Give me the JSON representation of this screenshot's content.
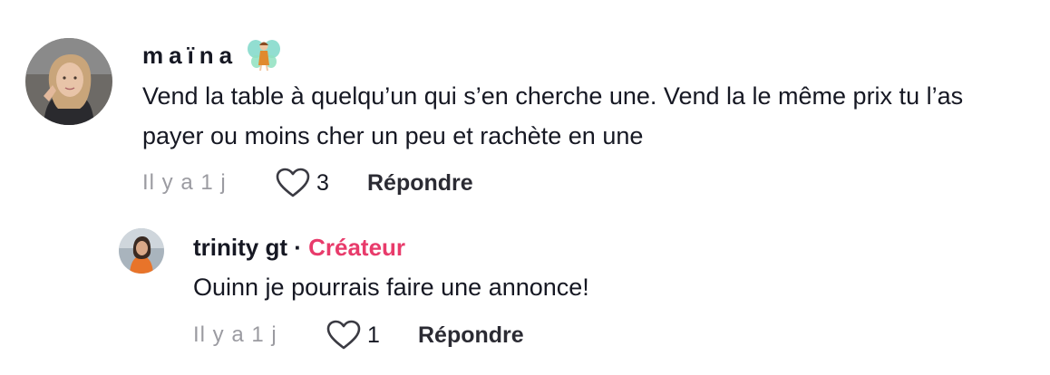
{
  "comment": {
    "username": "maïna",
    "text": "Vend la table à quelqu’un qui s’en cherche une. Vend la le même prix tu l’as payer ou moins cher un peu et rachète en une",
    "time": "Il y a 1 j",
    "likes": "3",
    "reply_label": "Répondre"
  },
  "reply": {
    "username": "trinity gt",
    "separator": " · ",
    "badge": "Créateur",
    "text": "Ouinn je pourrais faire une annonce!",
    "time": "Il y a 1 j",
    "likes": "1",
    "reply_label": "Répondre"
  },
  "icons": {
    "username_emoji": "fairy-icon",
    "like": "heart-icon"
  },
  "colors": {
    "creator_badge": "#e83b6b",
    "secondary_text": "#9b9ba1",
    "primary_text": "#161823"
  }
}
